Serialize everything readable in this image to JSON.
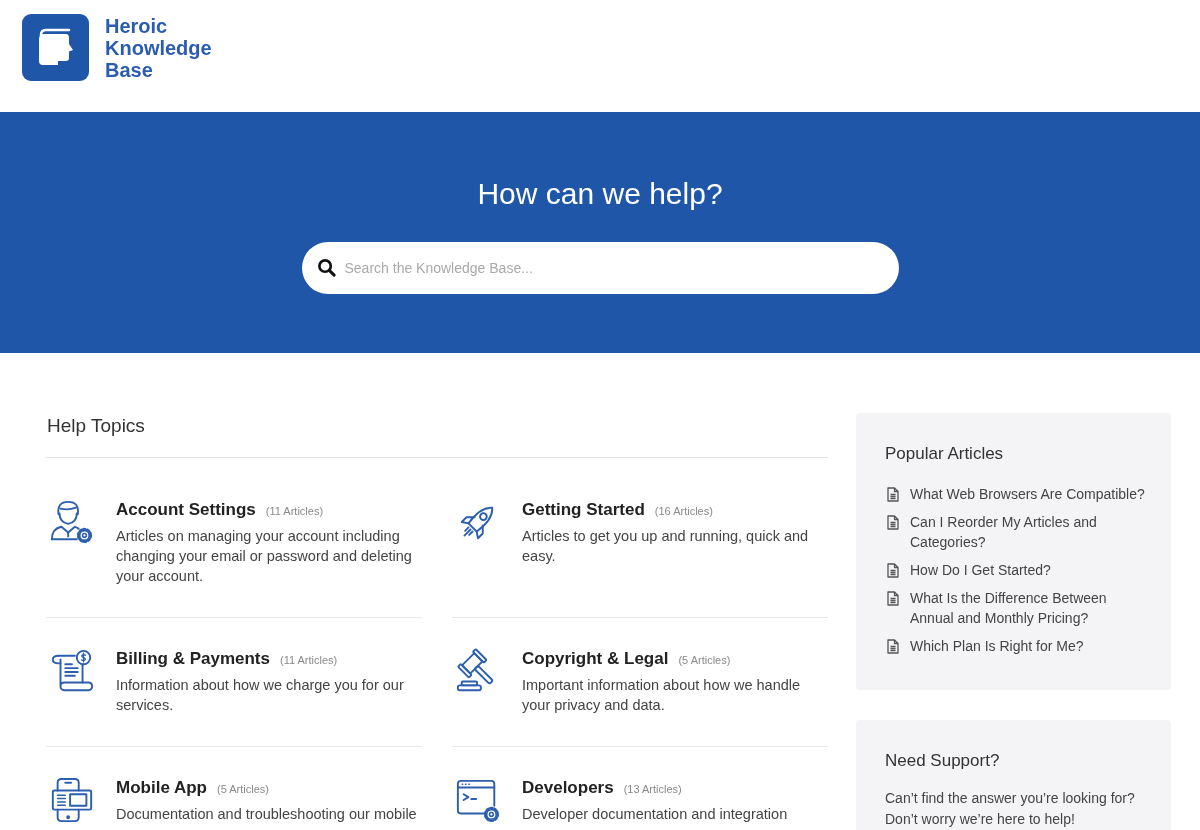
{
  "header": {
    "logo_text": "Heroic Knowledge Base"
  },
  "hero": {
    "title": "How can we help?",
    "search": {
      "placeholder": "Search the Knowledge Base..."
    }
  },
  "help_topics": {
    "title": "Help Topics",
    "topics": [
      {
        "kind": "user-gear",
        "title": "Account Settings",
        "count": "(11 Articles)",
        "description": "Articles on managing your account including changing your email or password and deleting your account."
      },
      {
        "kind": "rocket",
        "title": "Getting Started",
        "count": "(16 Articles)",
        "description": "Articles to get you up and running, quick and easy."
      },
      {
        "kind": "bill",
        "title": "Billing & Payments",
        "count": "(11 Articles)",
        "description": "Information about how we charge you for our services."
      },
      {
        "kind": "gavel",
        "title": "Copyright & Legal",
        "count": "(5 Articles)",
        "description": "Important information about how we handle your privacy and data."
      },
      {
        "kind": "mobile",
        "title": "Mobile App",
        "count": "(5 Articles)",
        "description": "Documentation and troubleshooting our mobile"
      },
      {
        "kind": "code-window",
        "title": "Developers",
        "count": "(13 Articles)",
        "description": "Developer documentation and integration"
      }
    ]
  },
  "sidebar": {
    "popular_articles": {
      "title": "Popular Articles",
      "articles": [
        "What Web Browsers Are Compatible?",
        "Can I Reorder My Articles and Categories?",
        "How Do I Get Started?",
        "What Is the Difference Between Annual and Monthly Pricing?",
        "Which Plan Is Right for Me?"
      ]
    },
    "support": {
      "title": "Need Support?",
      "text": "Can’t find the answer you’re looking for? Don’t worry we’re here to help!"
    }
  }
}
